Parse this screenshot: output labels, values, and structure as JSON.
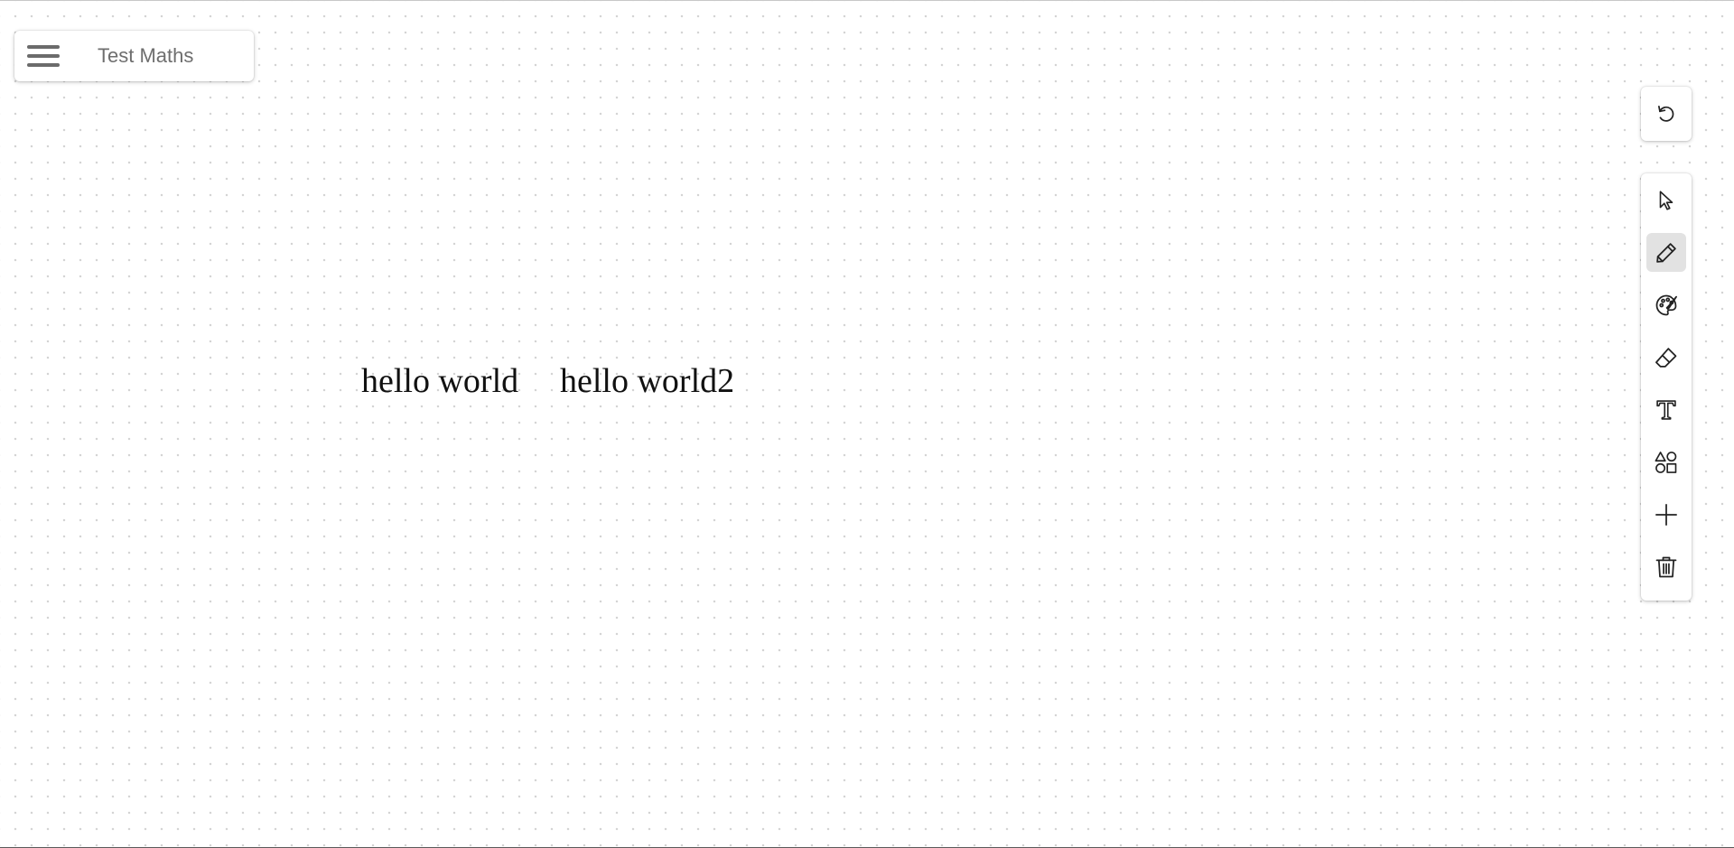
{
  "document": {
    "title": "Test Maths"
  },
  "canvas": {
    "texts": [
      {
        "text": "hello world"
      },
      {
        "text": "hello world2"
      }
    ]
  },
  "toolbar": {
    "undo_icon": "undo-icon",
    "active_tool": "pen",
    "tools": [
      {
        "id": "select",
        "icon": "cursor-arrow-icon"
      },
      {
        "id": "pen",
        "icon": "pencil-icon"
      },
      {
        "id": "color",
        "icon": "palette-icon"
      },
      {
        "id": "eraser",
        "icon": "eraser-icon"
      },
      {
        "id": "text",
        "icon": "text-icon"
      },
      {
        "id": "shapes",
        "icon": "shapes-icon"
      },
      {
        "id": "add",
        "icon": "plus-icon"
      },
      {
        "id": "delete",
        "icon": "trash-icon"
      }
    ]
  },
  "colors": {
    "background": "#ffffff",
    "grid_dot": "#d4d4d4",
    "active_tool_bg": "#e2e2e2",
    "text": "#111111",
    "title_text": "#6e6e6e"
  }
}
